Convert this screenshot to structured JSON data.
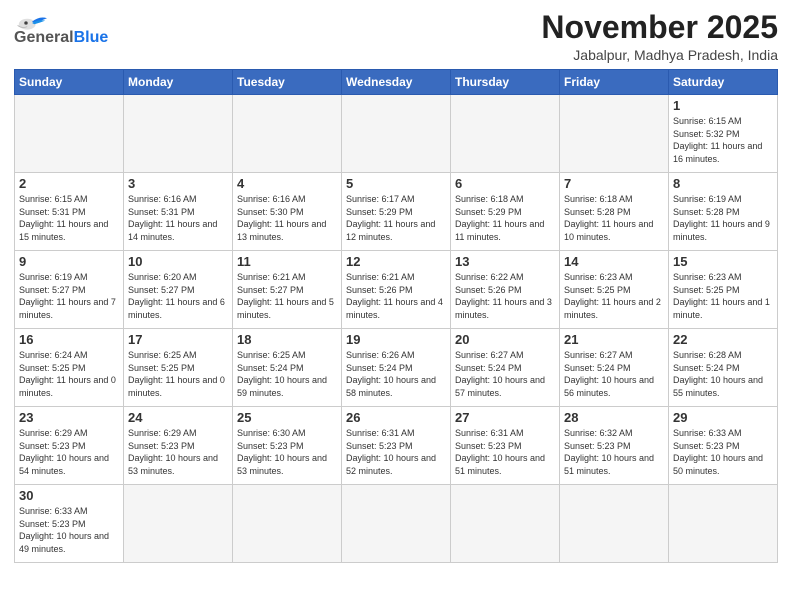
{
  "logo": {
    "general": "General",
    "blue": "Blue"
  },
  "header": {
    "month": "November 2025",
    "location": "Jabalpur, Madhya Pradesh, India"
  },
  "weekdays": [
    "Sunday",
    "Monday",
    "Tuesday",
    "Wednesday",
    "Thursday",
    "Friday",
    "Saturday"
  ],
  "weeks": [
    [
      {
        "day": "",
        "info": ""
      },
      {
        "day": "",
        "info": ""
      },
      {
        "day": "",
        "info": ""
      },
      {
        "day": "",
        "info": ""
      },
      {
        "day": "",
        "info": ""
      },
      {
        "day": "",
        "info": ""
      },
      {
        "day": "1",
        "info": "Sunrise: 6:15 AM\nSunset: 5:32 PM\nDaylight: 11 hours and 16 minutes."
      }
    ],
    [
      {
        "day": "2",
        "info": "Sunrise: 6:15 AM\nSunset: 5:31 PM\nDaylight: 11 hours and 15 minutes."
      },
      {
        "day": "3",
        "info": "Sunrise: 6:16 AM\nSunset: 5:31 PM\nDaylight: 11 hours and 14 minutes."
      },
      {
        "day": "4",
        "info": "Sunrise: 6:16 AM\nSunset: 5:30 PM\nDaylight: 11 hours and 13 minutes."
      },
      {
        "day": "5",
        "info": "Sunrise: 6:17 AM\nSunset: 5:29 PM\nDaylight: 11 hours and 12 minutes."
      },
      {
        "day": "6",
        "info": "Sunrise: 6:18 AM\nSunset: 5:29 PM\nDaylight: 11 hours and 11 minutes."
      },
      {
        "day": "7",
        "info": "Sunrise: 6:18 AM\nSunset: 5:28 PM\nDaylight: 11 hours and 10 minutes."
      },
      {
        "day": "8",
        "info": "Sunrise: 6:19 AM\nSunset: 5:28 PM\nDaylight: 11 hours and 9 minutes."
      }
    ],
    [
      {
        "day": "9",
        "info": "Sunrise: 6:19 AM\nSunset: 5:27 PM\nDaylight: 11 hours and 7 minutes."
      },
      {
        "day": "10",
        "info": "Sunrise: 6:20 AM\nSunset: 5:27 PM\nDaylight: 11 hours and 6 minutes."
      },
      {
        "day": "11",
        "info": "Sunrise: 6:21 AM\nSunset: 5:27 PM\nDaylight: 11 hours and 5 minutes."
      },
      {
        "day": "12",
        "info": "Sunrise: 6:21 AM\nSunset: 5:26 PM\nDaylight: 11 hours and 4 minutes."
      },
      {
        "day": "13",
        "info": "Sunrise: 6:22 AM\nSunset: 5:26 PM\nDaylight: 11 hours and 3 minutes."
      },
      {
        "day": "14",
        "info": "Sunrise: 6:23 AM\nSunset: 5:25 PM\nDaylight: 11 hours and 2 minutes."
      },
      {
        "day": "15",
        "info": "Sunrise: 6:23 AM\nSunset: 5:25 PM\nDaylight: 11 hours and 1 minute."
      }
    ],
    [
      {
        "day": "16",
        "info": "Sunrise: 6:24 AM\nSunset: 5:25 PM\nDaylight: 11 hours and 0 minutes."
      },
      {
        "day": "17",
        "info": "Sunrise: 6:25 AM\nSunset: 5:25 PM\nDaylight: 11 hours and 0 minutes."
      },
      {
        "day": "18",
        "info": "Sunrise: 6:25 AM\nSunset: 5:24 PM\nDaylight: 10 hours and 59 minutes."
      },
      {
        "day": "19",
        "info": "Sunrise: 6:26 AM\nSunset: 5:24 PM\nDaylight: 10 hours and 58 minutes."
      },
      {
        "day": "20",
        "info": "Sunrise: 6:27 AM\nSunset: 5:24 PM\nDaylight: 10 hours and 57 minutes."
      },
      {
        "day": "21",
        "info": "Sunrise: 6:27 AM\nSunset: 5:24 PM\nDaylight: 10 hours and 56 minutes."
      },
      {
        "day": "22",
        "info": "Sunrise: 6:28 AM\nSunset: 5:24 PM\nDaylight: 10 hours and 55 minutes."
      }
    ],
    [
      {
        "day": "23",
        "info": "Sunrise: 6:29 AM\nSunset: 5:23 PM\nDaylight: 10 hours and 54 minutes."
      },
      {
        "day": "24",
        "info": "Sunrise: 6:29 AM\nSunset: 5:23 PM\nDaylight: 10 hours and 53 minutes."
      },
      {
        "day": "25",
        "info": "Sunrise: 6:30 AM\nSunset: 5:23 PM\nDaylight: 10 hours and 53 minutes."
      },
      {
        "day": "26",
        "info": "Sunrise: 6:31 AM\nSunset: 5:23 PM\nDaylight: 10 hours and 52 minutes."
      },
      {
        "day": "27",
        "info": "Sunrise: 6:31 AM\nSunset: 5:23 PM\nDaylight: 10 hours and 51 minutes."
      },
      {
        "day": "28",
        "info": "Sunrise: 6:32 AM\nSunset: 5:23 PM\nDaylight: 10 hours and 51 minutes."
      },
      {
        "day": "29",
        "info": "Sunrise: 6:33 AM\nSunset: 5:23 PM\nDaylight: 10 hours and 50 minutes."
      }
    ],
    [
      {
        "day": "30",
        "info": "Sunrise: 6:33 AM\nSunset: 5:23 PM\nDaylight: 10 hours and 49 minutes."
      },
      {
        "day": "",
        "info": ""
      },
      {
        "day": "",
        "info": ""
      },
      {
        "day": "",
        "info": ""
      },
      {
        "day": "",
        "info": ""
      },
      {
        "day": "",
        "info": ""
      },
      {
        "day": "",
        "info": ""
      }
    ]
  ]
}
